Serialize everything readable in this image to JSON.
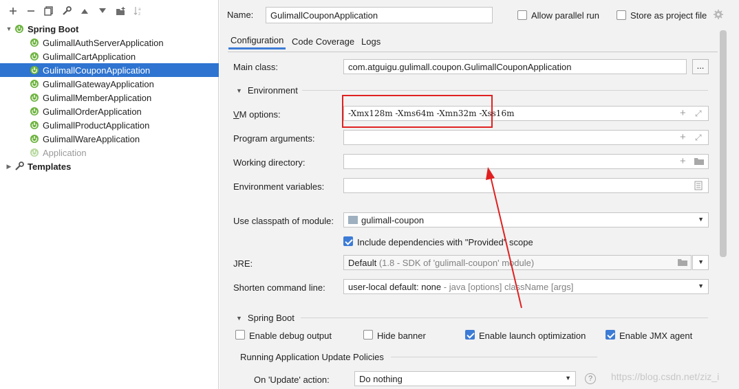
{
  "toolbar": {
    "icons": [
      "add-icon",
      "remove-icon",
      "copy-icon",
      "wrench-icon",
      "move-up-icon",
      "move-down-icon",
      "new-folder-icon",
      "sort-icon"
    ]
  },
  "tree": {
    "spring_boot_label": "Spring Boot",
    "configs": [
      "GulimallAuthServerApplication",
      "GulimallCartApplication",
      "GulimallCouponApplication",
      "GulimallGatewayApplication",
      "GulimallMemberApplication",
      "GulimallOrderApplication",
      "GulimallProductApplication",
      "GulimallWareApplication",
      "Application"
    ],
    "selected_index": 2,
    "templates_label": "Templates"
  },
  "header": {
    "name_label": "Name:",
    "name_value": "GulimallCouponApplication",
    "allow_parallel_label": "Allow parallel run",
    "store_as_project_label": "Store as project file"
  },
  "tabs": [
    "Configuration",
    "Code Coverage",
    "Logs"
  ],
  "form": {
    "main_class_label": "Main class:",
    "main_class_value": "com.atguigu.gulimall.coupon.GulimallCouponApplication",
    "main_class_btn": "...",
    "environment_label": "Environment",
    "vm_options_label": "VM options:",
    "vm_options_value": "-Xmx128m -Xms64m -Xmn32m -Xss16m",
    "program_args_label": "Program arguments:",
    "working_dir_label": "Working directory:",
    "env_vars_label": "Environment variables:",
    "classpath_label": "Use classpath of module:",
    "classpath_value": "gulimall-coupon",
    "include_deps_label": "Include dependencies with \"Provided\" scope",
    "jre_label": "JRE:",
    "jre_value_main": "Default",
    "jre_value_hint": "(1.8 - SDK of 'gulimall-coupon' module)",
    "shorten_label": "Shorten command line:",
    "shorten_value_main": "user-local default: none",
    "shorten_value_hint": "- java [options] className [args]"
  },
  "spring_boot": {
    "section_label": "Spring Boot",
    "debug_label": "Enable debug output",
    "hide_banner_label": "Hide banner",
    "launch_opt_label": "Enable launch optimization",
    "jmx_label": "Enable JMX agent",
    "update_policies_label": "Running Application Update Policies",
    "on_update_label": "On 'Update' action:",
    "on_update_value": "Do nothing"
  },
  "checkbox_states": {
    "allow_parallel": false,
    "store_as_project": false,
    "include_deps": true,
    "debug": false,
    "hide_banner": false,
    "launch_opt": true,
    "jmx": true
  },
  "watermark": "https://blog.csdn.net/ziz_i",
  "colors": {
    "selection": "#2f74d0",
    "accent": "#3c7bd6",
    "annotation_red": "#e02020"
  }
}
